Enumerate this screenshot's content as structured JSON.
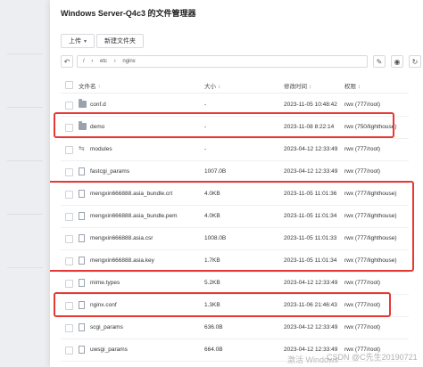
{
  "window": {
    "title": "Windows Server-Q4c3 的文件管理器"
  },
  "toolbar": {
    "upload_label": "上传",
    "new_folder_label": "新建文件夹"
  },
  "path": {
    "segments": [
      "/",
      "etc",
      "nginx"
    ]
  },
  "table": {
    "headers": {
      "name": "文件名",
      "size": "大小",
      "modified": "修改时间",
      "permission": "权限"
    },
    "rows": [
      {
        "name": "conf.d",
        "size": "-",
        "modified": "2023-11-05 10:48:42",
        "permission": "rwx (777/root)",
        "kind": "folder"
      },
      {
        "name": "demo",
        "size": "-",
        "modified": "2023-11-08 8:22:14",
        "permission": "rwx (750/lighthouse)",
        "kind": "folder"
      },
      {
        "name": "modules",
        "size": "-",
        "modified": "2023-04-12 12:33:49",
        "permission": "rwx (777/root)",
        "kind": "link"
      },
      {
        "name": "fastcgi_params",
        "size": "1007.0B",
        "modified": "2023-04-12 12:33:49",
        "permission": "rwx (777/root)",
        "kind": "file"
      },
      {
        "name": "mengxin666888.asia_bundle.crt",
        "size": "4.0KB",
        "modified": "2023-11-05 11:01:36",
        "permission": "rwx (777/lighthouse)",
        "kind": "file"
      },
      {
        "name": "mengxin666888.asia_bundle.pem",
        "size": "4.0KB",
        "modified": "2023-11-05 11:01:34",
        "permission": "rwx (777/lighthouse)",
        "kind": "file"
      },
      {
        "name": "mengxin666888.asia.csr",
        "size": "1008.0B",
        "modified": "2023-11-05 11:01:33",
        "permission": "rwx (777/lighthouse)",
        "kind": "file"
      },
      {
        "name": "mengxin666888.asia.key",
        "size": "1.7KB",
        "modified": "2023-11-05 11:01:34",
        "permission": "rwx (777/lighthouse)",
        "kind": "file"
      },
      {
        "name": "mime.types",
        "size": "5.2KB",
        "modified": "2023-04-12 12:33:49",
        "permission": "rwx (777/root)",
        "kind": "file"
      },
      {
        "name": "nginx.conf",
        "size": "1.3KB",
        "modified": "2023-11-06 21:46:43",
        "permission": "rwx (777/root)",
        "kind": "file"
      },
      {
        "name": "scgi_params",
        "size": "636.0B",
        "modified": "2023-04-12 12:33:49",
        "permission": "rwx (777/root)",
        "kind": "file"
      },
      {
        "name": "uwsgi_params",
        "size": "664.0B",
        "modified": "2023-04-12 12:33:49",
        "permission": "rwx (777/root)",
        "kind": "file"
      }
    ]
  },
  "overlay": {
    "activation": "激活 Windows",
    "credit": "CSDN @C先生20190721"
  },
  "colors": {
    "highlight": "#e53935"
  },
  "icons": {
    "back": "arrow-icon",
    "edit": "edit-icon",
    "view": "eye-icon",
    "refresh": "refresh-icon"
  }
}
